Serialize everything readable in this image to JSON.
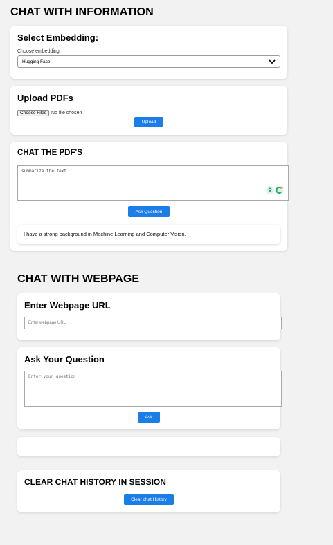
{
  "page_title": "CHAT WITH INFORMATION",
  "embedding": {
    "title": "Select Embedding:",
    "label": "Choose embedding:",
    "selected": "Hugging Face"
  },
  "upload": {
    "title": "Upload PDFs",
    "choose_files": "Choose Files",
    "no_file": "No file chosen",
    "button": "Upload"
  },
  "chat_pdf": {
    "title": "CHAT THE PDF'S",
    "question_value": "summarize the text",
    "ask_button": "Ask Question",
    "answer": "I have a strong background in Machine Learning and Computer Vision."
  },
  "webpage": {
    "section_title": "CHAT WITH WEBPAGE",
    "url_title": "Enter Webpage URL",
    "url_placeholder": "Enter webpage URL",
    "question_title": "Ask Your Question",
    "question_placeholder": "Enter your question",
    "ask_button": "Ask"
  },
  "clear": {
    "title": "CLEAR CHAT HISTORY IN SESSION",
    "button": "Clear chat History"
  },
  "colors": {
    "accent": "#1a7de8",
    "background": "#f2f2f2"
  }
}
